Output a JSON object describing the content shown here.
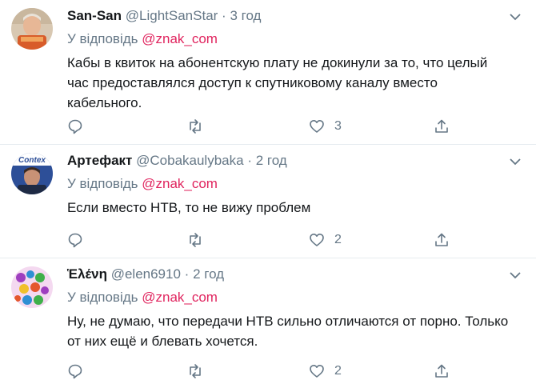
{
  "tweets": [
    {
      "name": "San-San",
      "handle": "@LightSanStar",
      "dot": "·",
      "time": "3 год",
      "reply_prefix": "У відповідь",
      "reply_mention": "@znak_com",
      "text": "Кабы в квиток на абонентскую плату не докинули за то, что целый час предоставлялся доступ к спутниковому каналу вместо кабельного.",
      "like_count": "3",
      "avatar_colors": {
        "bg": "#d8c8b2",
        "face": "#e7b796",
        "shirt": "#d85c2a"
      }
    },
    {
      "name": "Артефакт",
      "handle": "@Cobakaulybaka",
      "dot": "·",
      "time": "2 год",
      "reply_prefix": "У відповідь",
      "reply_mention": "@znak_com",
      "text": "Если вместо НТВ, то не вижу проблем",
      "like_count": "2",
      "avatar_colors": {
        "bg": "#2d4f98",
        "face": "#c89276",
        "shirt": "#1e2a44"
      },
      "avatar_logo_text": "Contex"
    },
    {
      "name": "Ἑλένη",
      "handle": "@elen6910",
      "dot": "·",
      "time": "2 год",
      "reply_prefix": "У відповідь",
      "reply_mention": "@znak_com",
      "text": "Ну, не думаю, что передачи НТВ сильно отличаются от порно. Только от них ещё и блевать хочется.",
      "like_count": "2",
      "avatar_colors": {
        "bg": "#f4d9f0",
        "stripes": [
          "#9e3fbf",
          "#2f8fd4",
          "#3fb04a",
          "#f0c02a",
          "#e4572e"
        ]
      }
    }
  ],
  "colors": {
    "text": "#14171a",
    "secondary": "#657786",
    "mention": "#e0245e",
    "divider": "#e6ecf0"
  }
}
